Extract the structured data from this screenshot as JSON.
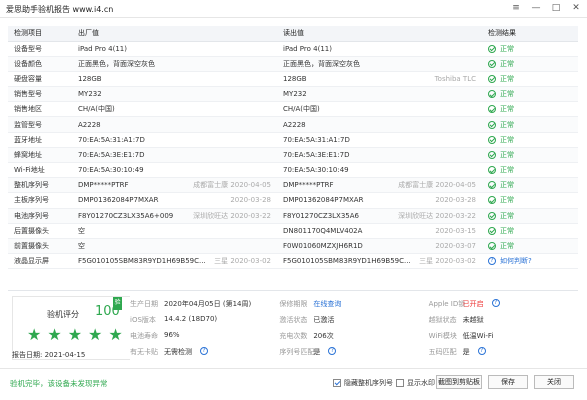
{
  "window": {
    "title": "爱思助手验机报告 www.i4.cn",
    "controls": [
      "≡",
      "—",
      "□",
      "✕"
    ]
  },
  "table": {
    "headers": [
      "检测项目",
      "出厂值",
      "读出值",
      "检测结果"
    ],
    "rows": [
      {
        "item": "设备型号",
        "factory": "iPad Pro 4(11)",
        "factory_note": "",
        "read": "iPad Pro 4(11)",
        "read_note": "",
        "result": "正常",
        "result_type": "ok"
      },
      {
        "item": "设备颜色",
        "factory": "正面黑色，背面深空灰色",
        "factory_note": "",
        "read": "正面黑色，背面深空灰色",
        "read_note": "",
        "result": "正常",
        "result_type": "ok"
      },
      {
        "item": "硬盘容量",
        "factory": "128GB",
        "factory_note": "",
        "read": "128GB",
        "read_note": "Toshiba TLC",
        "result": "正常",
        "result_type": "ok"
      },
      {
        "item": "销售型号",
        "factory": "MY232",
        "factory_note": "",
        "read": "MY232",
        "read_note": "",
        "result": "正常",
        "result_type": "ok"
      },
      {
        "item": "销售地区",
        "factory": "CH/A(中国)",
        "factory_note": "",
        "read": "CH/A(中国)",
        "read_note": "",
        "result": "正常",
        "result_type": "ok"
      },
      {
        "item": "监管型号",
        "factory": "A2228",
        "factory_note": "",
        "read": "A2228",
        "read_note": "",
        "result": "正常",
        "result_type": "ok"
      },
      {
        "item": "蓝牙地址",
        "factory": "70:EA:5A:31:A1:7D",
        "factory_note": "",
        "read": "70:EA:5A:31:A1:7D",
        "read_note": "",
        "result": "正常",
        "result_type": "ok"
      },
      {
        "item": "蜂窝地址",
        "factory": "70:EA:5A:3E:E1:7D",
        "factory_note": "",
        "read": "70:EA:5A:3E:E1:7D",
        "read_note": "",
        "result": "正常",
        "result_type": "ok"
      },
      {
        "item": "Wi-Fi地址",
        "factory": "70:EA:5A:30:10:49",
        "factory_note": "",
        "read": "70:EA:5A:30:10:49",
        "read_note": "",
        "result": "正常",
        "result_type": "ok"
      },
      {
        "item": "整机序列号",
        "factory": "DMP*****PTRF",
        "factory_note": "成都富士康 2020-04-05",
        "read": "DMP*****PTRF",
        "read_note": "成都富士康 2020-04-05",
        "result": "正常",
        "result_type": "ok"
      },
      {
        "item": "主板序列号",
        "factory": "DMP01362084P7MXAR",
        "factory_note": "2020-03-28",
        "read": "DMP01362084P7MXAR",
        "read_note": "2020-03-28",
        "result": "正常",
        "result_type": "ok"
      },
      {
        "item": "电池序列号",
        "factory": "F8Y01270CZ3LX35A6+009",
        "factory_note": "深圳欣旺达 2020-03-22",
        "read": "F8Y01270CZ3LX35A6",
        "read_note": "深圳欣旺达 2020-03-22",
        "result": "正常",
        "result_type": "ok"
      },
      {
        "item": "后置摄像头",
        "factory": "空",
        "factory_note": "",
        "read": "DN801170Q4MLV402A",
        "read_note": "2020-03-15",
        "result": "正常",
        "result_type": "ok"
      },
      {
        "item": "前置摄像头",
        "factory": "空",
        "factory_note": "",
        "read": "F0W01060MZXJH6R1D",
        "read_note": "2020-03-07",
        "result": "正常",
        "result_type": "ok"
      },
      {
        "item": "液晶显示屏",
        "factory": "F5G010105SBM83R9YD1H69B59C...",
        "factory_note": "三星 2020-03-02",
        "read": "F5G010105SBM83R9YD1H69B59C...",
        "read_note": "三星 2020-03-02",
        "result": "如何判断?",
        "result_type": "question"
      }
    ]
  },
  "summary": {
    "score_label": "验机评分",
    "score": "100",
    "badge": "验",
    "stars": 5,
    "date_label": "报告日期:",
    "date": "2021-04-15",
    "info": [
      [
        {
          "k": "生产日期",
          "v": "2020年04月05日 (第14周)",
          "style": "",
          "icon": false
        },
        {
          "k": "保修期限",
          "v": "在线查询",
          "style": "lnk",
          "icon": false
        },
        {
          "k": "Apple ID锁",
          "v": "已开启",
          "style": "red",
          "icon": true
        }
      ],
      [
        {
          "k": "iOS版本",
          "v": "14.4.2 (18D70)",
          "style": "",
          "icon": false
        },
        {
          "k": "激活状态",
          "v": "已激活",
          "style": "",
          "icon": false
        },
        {
          "k": "越狱状态",
          "v": "未越狱",
          "style": "",
          "icon": false
        }
      ],
      [
        {
          "k": "电池寿命",
          "v": "96%",
          "style": "",
          "icon": false
        },
        {
          "k": "充电次数",
          "v": "206次",
          "style": "",
          "icon": false
        },
        {
          "k": "WiFi模块",
          "v": "低温Wi-Fi",
          "style": "",
          "icon": false
        }
      ],
      [
        {
          "k": "有无卡贴",
          "v": "无需检测",
          "style": "",
          "icon": true
        },
        {
          "k": "序列号匹配",
          "v": "是",
          "style": "",
          "icon": true
        },
        {
          "k": "五码匹配",
          "v": "是",
          "style": "",
          "icon": true
        }
      ]
    ]
  },
  "footer": {
    "message": "验机完毕，该设备未发现异常",
    "hide_serial": "隐藏整机序列号",
    "show_watermark": "显示水印",
    "screenshot": "截图到剪贴板",
    "save": "保存",
    "close": "关闭"
  },
  "colors": {
    "ok": "#2fa84f",
    "link": "#2b73d6",
    "alert": "#e33"
  }
}
